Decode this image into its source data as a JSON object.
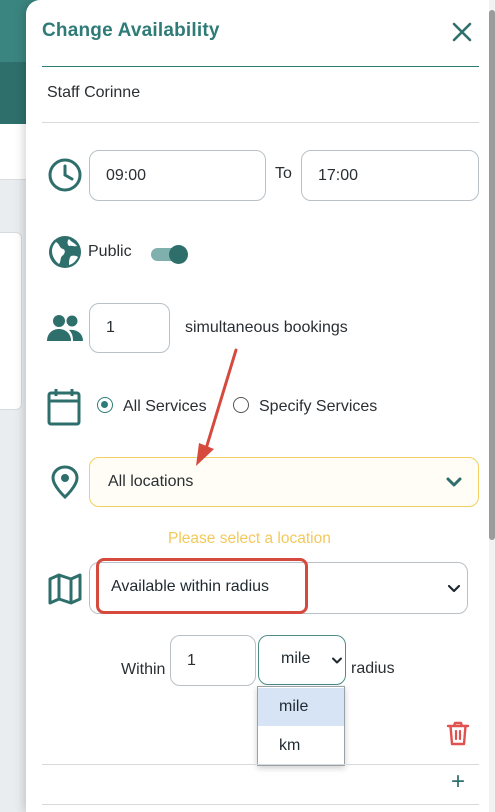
{
  "modal": {
    "title": "Change Availability",
    "close_glyph": "✕",
    "staff_name": "Staff Corinne"
  },
  "time": {
    "start": "09:00",
    "to_label": "To",
    "end": "17:00"
  },
  "visibility": {
    "label": "Public",
    "enabled": true
  },
  "bookings": {
    "count": "1",
    "label": "simultaneous bookings"
  },
  "services": {
    "options": [
      {
        "label": "All Services",
        "checked": true
      },
      {
        "label": "Specify Services",
        "checked": false
      }
    ]
  },
  "location": {
    "selected": "All locations",
    "warning": "Please select a location"
  },
  "radius": {
    "mode": "Available within radius",
    "within_label": "Within",
    "distance": "1",
    "unit": "mile",
    "unit_options": [
      "mile",
      "km"
    ],
    "highlighted_unit": "mile",
    "suffix": "radius"
  },
  "actions": {
    "add_glyph": "+"
  },
  "colors": {
    "accent": "#2e7b78",
    "warning": "#f3c95c",
    "delete": "#e0524f",
    "annotation": "#d64a3e"
  },
  "icons": [
    "close-icon",
    "clock-icon",
    "globe-icon",
    "people-icon",
    "calendar-icon",
    "map-pin-icon",
    "map-icon",
    "chevron-down-icon",
    "trash-icon",
    "plus-icon",
    "arrow-annotation"
  ]
}
